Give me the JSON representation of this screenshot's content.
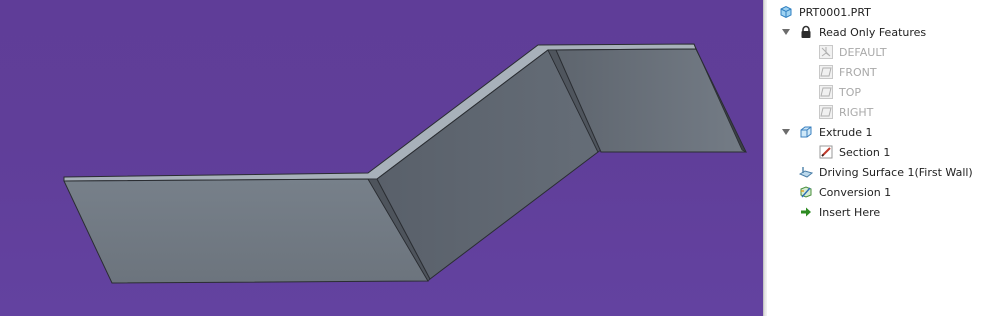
{
  "model_tree": {
    "items": [
      {
        "label": "PRT0001.PRT",
        "icon": "part-icon",
        "expanded": null,
        "disabled": false
      },
      {
        "label": "Read Only Features",
        "icon": "lock-icon",
        "expanded": true,
        "disabled": false
      },
      {
        "label": "DEFAULT",
        "icon": "datum-csys-icon",
        "expanded": null,
        "disabled": true
      },
      {
        "label": "FRONT",
        "icon": "datum-plane-icon",
        "expanded": null,
        "disabled": true
      },
      {
        "label": "TOP",
        "icon": "datum-plane-icon",
        "expanded": null,
        "disabled": true
      },
      {
        "label": "RIGHT",
        "icon": "datum-plane-icon",
        "expanded": null,
        "disabled": true
      },
      {
        "label": "Extrude 1",
        "icon": "extrude-icon",
        "expanded": true,
        "disabled": false
      },
      {
        "label": "Section 1",
        "icon": "sketch-icon",
        "expanded": null,
        "disabled": false
      },
      {
        "label": "Driving Surface 1(First Wall)",
        "icon": "driving-surface-icon",
        "expanded": null,
        "disabled": false
      },
      {
        "label": "Conversion 1",
        "icon": "conversion-icon",
        "expanded": null,
        "disabled": false
      },
      {
        "label": "Insert Here",
        "icon": "insert-arrow-icon",
        "expanded": null,
        "disabled": false
      }
    ]
  },
  "colors": {
    "viewport_background": "#603e99",
    "model_face": "#6e7780",
    "model_edge": "#2a2d32",
    "disabled_text": "#a9a9a9",
    "insert_arrow": "#2e8b22"
  }
}
